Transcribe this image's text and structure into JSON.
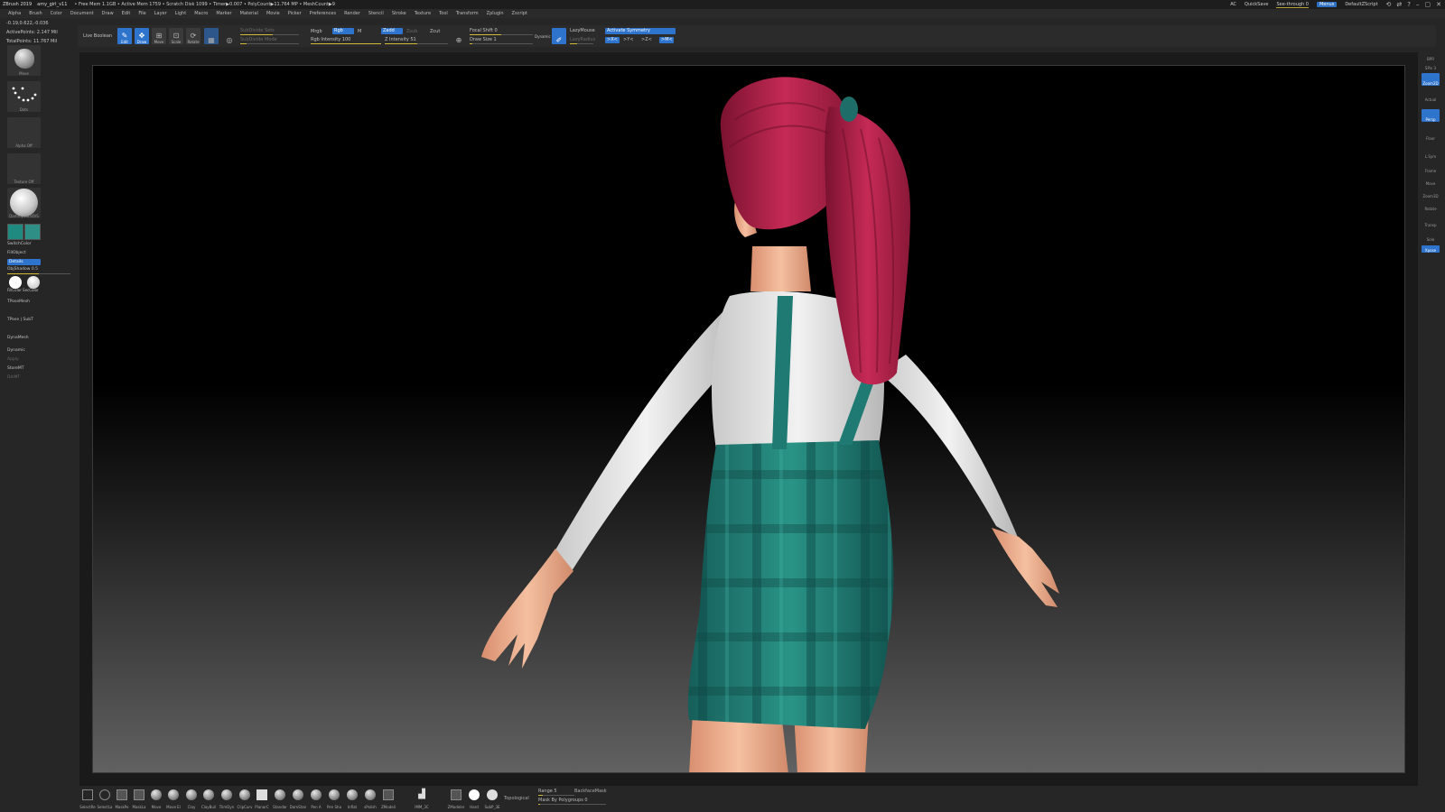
{
  "titlebar": {
    "app": "ZBrush 2019",
    "file": "amy_girl_v11",
    "stats": "• Free Mem 1.1GB • Active Mem 1759 • Scratch Disk 1099 • Timer▶0.007 • PolyCount▶11.764 MP • MeshCount▶9",
    "ac": "AC",
    "quicksave": "QuickSave",
    "seethrough": "See-through  0",
    "menus": "Menus",
    "script": "DefaultZScript"
  },
  "menubar": [
    "Alpha",
    "Brush",
    "Color",
    "Document",
    "Draw",
    "Edit",
    "File",
    "Layer",
    "Light",
    "Macro",
    "Marker",
    "Material",
    "Movie",
    "Picker",
    "Preferences",
    "Render",
    "Stencil",
    "Stroke",
    "Texture",
    "Tool",
    "Transform",
    "Zplugin",
    "Zscript"
  ],
  "left_info": {
    "coords": "-0.19,0.622,-0.036",
    "active_points": "ActivePoints: 2.147 Mil",
    "total_points": "TotalPoints: 11.767 Mil"
  },
  "toolbar": {
    "live_boolean": "Live Boolean",
    "buttons": [
      "Edit",
      "Draw",
      "Move",
      "Scale",
      "Rotate"
    ],
    "subdiv_label": "SubDivide Sets",
    "sub_label2": "SubDivide Mode",
    "mrgb": "Mrgb",
    "rgb": "Rgb",
    "m": "M",
    "rgb_intensity": "Rgb Intensity 100",
    "zadd": "Zadd",
    "zsub": "Zsub",
    "zcut": "Zcut",
    "z_intensity": "Z Intensity 51",
    "focal_shift": "Focal Shift 0",
    "draw_size": "Draw Size 1",
    "dynamic": "Dynamic",
    "lazymouse": "LazyMouse",
    "lazyradius": "LazyRadius",
    "activate_symmetry": "Activate Symmetry",
    "sym_x": ">X<",
    "sym_y": ">Y<",
    "sym_z": ">Z<",
    "sym_m": ">M<"
  },
  "left_shelf": {
    "brush": "Move",
    "stroke": "Dots",
    "alpha": "Alpha Off",
    "texture": "Texture Off",
    "material": "DammyStandVS",
    "switch_color": "SwitchColor",
    "fill_object": "FillObject",
    "details": "Details",
    "obj_shadow": "ObjShadow 0.5",
    "fill_labels": "FillColor SecColor",
    "tpose_mesh": "TPoseMesh",
    "tpose_subt": "TPose | SubT",
    "dynamesh": "DynaMesh",
    "dynamic": "Dynamic",
    "apply": "Apply",
    "store_mt": "StoreMT",
    "del_mt": "DelMT"
  },
  "right_shelf": {
    "bpr": "BPR",
    "spix": "SPix 3",
    "zoom2d": "Zoom2D",
    "actual": "Actual",
    "persp": "Persp",
    "floor": "Floor",
    "lsym": "L.Sym",
    "frame": "Frame",
    "move": "Move",
    "zoom3d": "Zoom3D",
    "rotate": "Rotate",
    "transp": "Transp",
    "solo": "Solo",
    "xpose": "Xpose"
  },
  "bottom_brushes": [
    "SelectRe",
    "SelectLa",
    "MaskPe",
    "MaskLa",
    "Move",
    "Move El",
    "Clay",
    "ClayBuil",
    "TrimDyn",
    "ClipCurv",
    "PlanarC",
    "Standar",
    "DamStan",
    "Pen A",
    "Pen Sha",
    "Inflat",
    "sPolish",
    "ZModeli",
    "IMM_3C",
    "ZModeler",
    "Hard",
    "SubP_3E"
  ],
  "bottom_right": {
    "topological": "Topological",
    "range": "Range 5",
    "backface_mask": "BackfaceMask",
    "mask_polygroups": "Mask By Polygroups 0"
  },
  "colors": {
    "accent": "#2f74cc",
    "hair": "#b8234b",
    "dress": "#1f7f77",
    "shirt": "#e8e8e8",
    "skin": "#f0b494"
  }
}
